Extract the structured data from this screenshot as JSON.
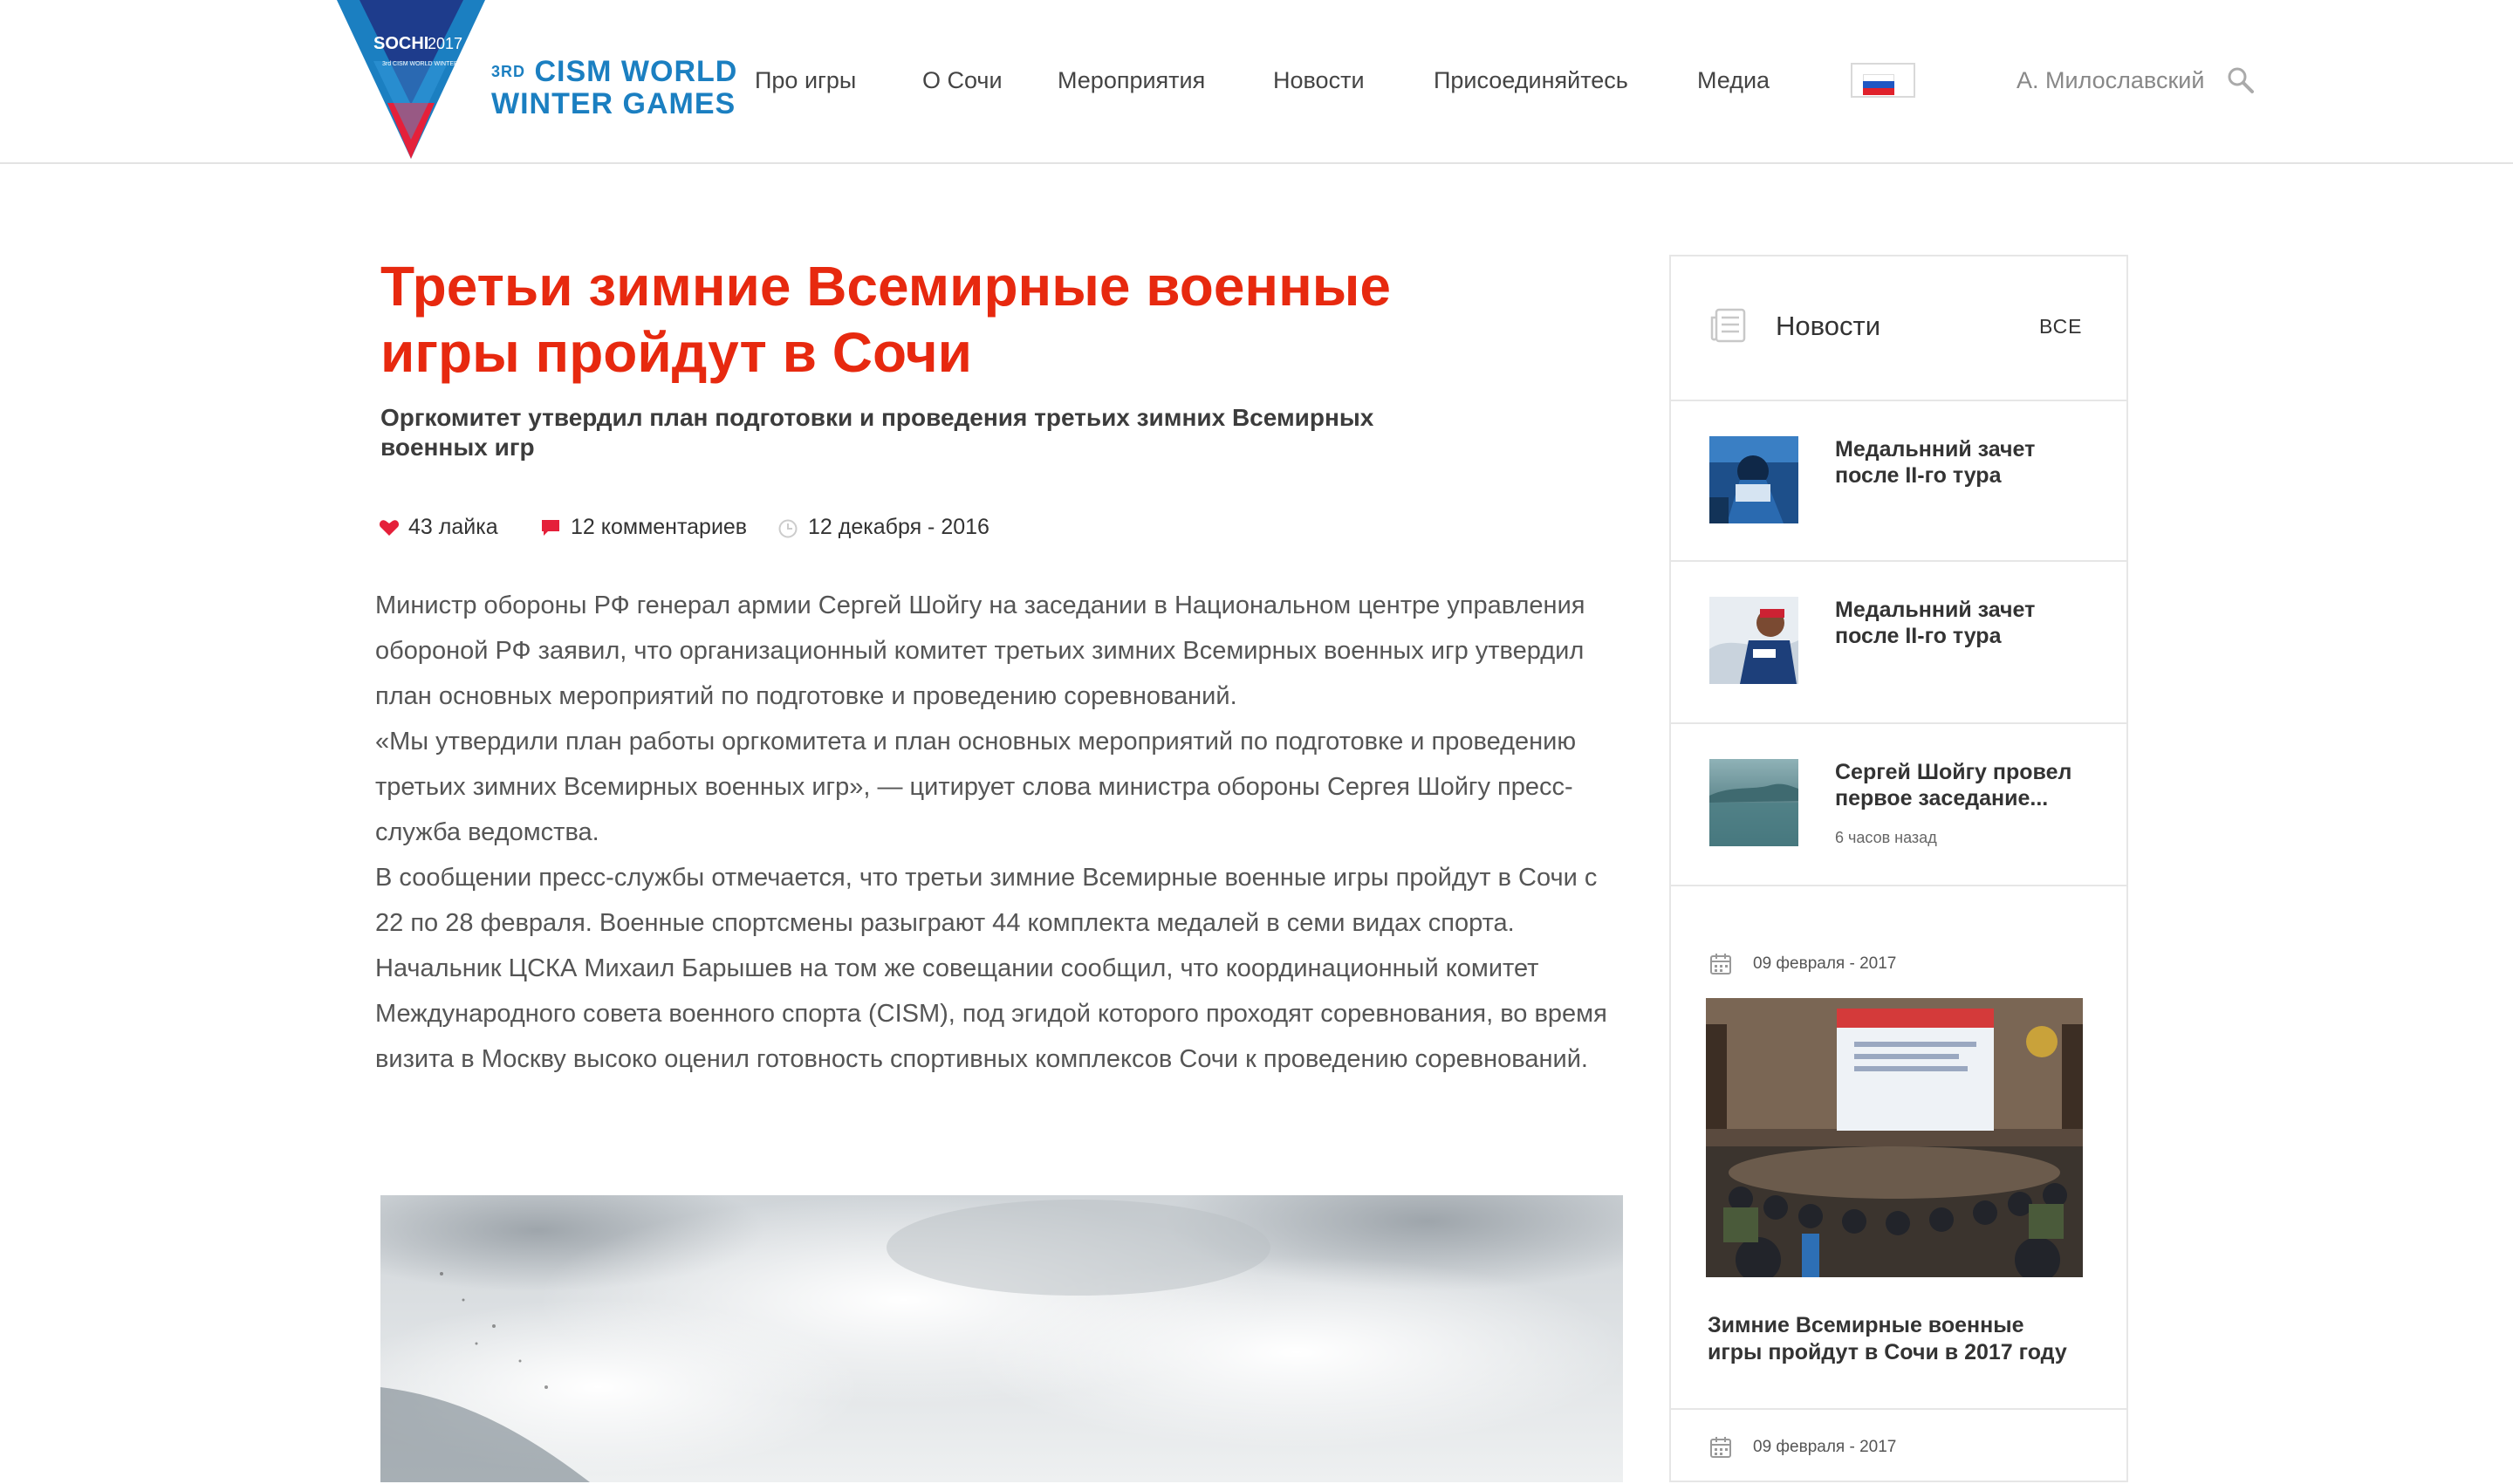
{
  "header": {
    "logo": {
      "badge_line1": "SOCHI",
      "badge_year": "2017",
      "badge_small": "3rd CISM WORLD WINTER GAMES",
      "title_ordinal": "3RD",
      "title_line1": "CISM WORLD",
      "title_line2": "WINTER GAMES",
      "colors": {
        "blue": "#1b7fc1",
        "red": "#e5203a",
        "navy": "#1e3c8c"
      }
    },
    "nav": [
      {
        "label": "Про игры"
      },
      {
        "label": "О Сочи"
      },
      {
        "label": "Мероприятия"
      },
      {
        "label": "Новости"
      },
      {
        "label": "Присоединяйтесь"
      },
      {
        "label": "Медиа"
      }
    ],
    "language": {
      "flag": "russia-flag-icon"
    },
    "user_name": "А. Милославский",
    "search_icon": "search-icon"
  },
  "article": {
    "title": "Третьи зимние Всемирные военные игры пройдут в Сочи",
    "subtitle": "Оргкомитет утвердил план подготовки и проведения третьих зимних Всемирных военных игр",
    "meta": {
      "likes": "43 лайка",
      "comments": "12 комментариев",
      "date": "12 декабря - 2016"
    },
    "body": [
      "Министр обороны РФ генерал армии Сергей Шойгу на заседании в Национальном центре управления обороной РФ заявил, что организационный комитет третьих зимних Всемирных военных игр утвердил план основных мероприятий по подготовке и проведению соревнований.",
      "«Мы утвердили план работы оргкомитета и план основных мероприятий по подготовке и проведению третьих зимних Всемирных военных игр», — цитирует слова министра обороны Сергея Шойгу пресс-служба ведомства.",
      "В сообщении пресс-службы отмечается, что третьи зимние Всемирные военные игры пройдут в Сочи с 22 по 28 февраля. Военные спортсмены разыграют 44 комплекта медалей в семи видах спорта. Начальник ЦСКА Михаил Барышев на том же совещании сообщил, что координационный комитет Международного совета военного спорта (CISM), под эгидой которого проходят соревнования, во время визита в Москву высоко оценил готовность спортивных комплексов Сочи к проведению соревнований."
    ],
    "accent_color": "#e7290f"
  },
  "sidebar": {
    "title": "Новости",
    "all_label": "ВСЕ",
    "items": [
      {
        "title": "Медальнний зачет после II-го тура",
        "time": ""
      },
      {
        "title": "Медальнний зачет после II-го тура",
        "time": ""
      },
      {
        "title": "Сергей Шойгу провел первое заседание...",
        "time": "6 часов назад"
      }
    ],
    "features": [
      {
        "date": "09 февраля - 2017",
        "title": "Зимние Всемирные военные игры пройдут в Сочи в 2017 году"
      },
      {
        "date": "09 февраля - 2017",
        "title": ""
      }
    ]
  }
}
